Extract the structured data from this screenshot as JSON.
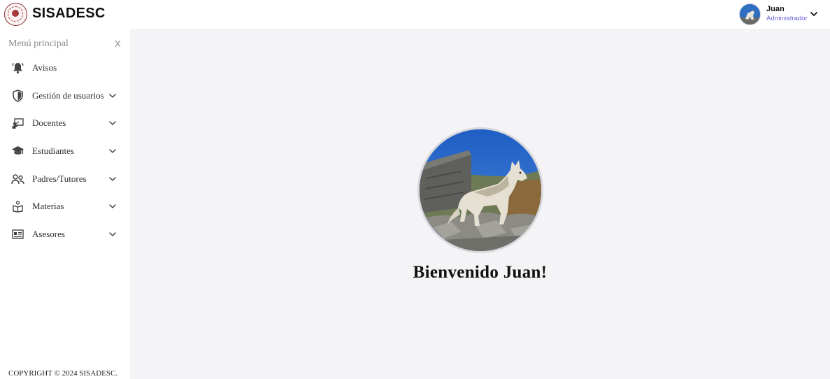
{
  "header": {
    "brand": "SISADESC",
    "user": {
      "name": "Juan",
      "role": "Administrador"
    }
  },
  "sidebar": {
    "title": "Menú principal",
    "close_label": "X",
    "items": [
      {
        "label": "Avisos",
        "icon": "bell-icon",
        "expandable": false
      },
      {
        "label": "Gestión de usuarios",
        "icon": "shield-icon",
        "expandable": true
      },
      {
        "label": "Docentes",
        "icon": "teacher-board-icon",
        "expandable": true
      },
      {
        "label": "Estudiantes",
        "icon": "graduation-cap-icon",
        "expandable": true
      },
      {
        "label": "Padres/Tutores",
        "icon": "users-icon",
        "expandable": true
      },
      {
        "label": "Materias",
        "icon": "book-icon",
        "expandable": true
      },
      {
        "label": "Asesores",
        "icon": "id-card-icon",
        "expandable": true
      }
    ],
    "copyright": "COPYRIGHT © 2024 SISADESC."
  },
  "main": {
    "welcome": "Bienvenido Juan!"
  },
  "colors": {
    "accent_role": "#6a63d8",
    "main_bg": "#f4f4f6",
    "logo_red": "#8a2b2b"
  }
}
